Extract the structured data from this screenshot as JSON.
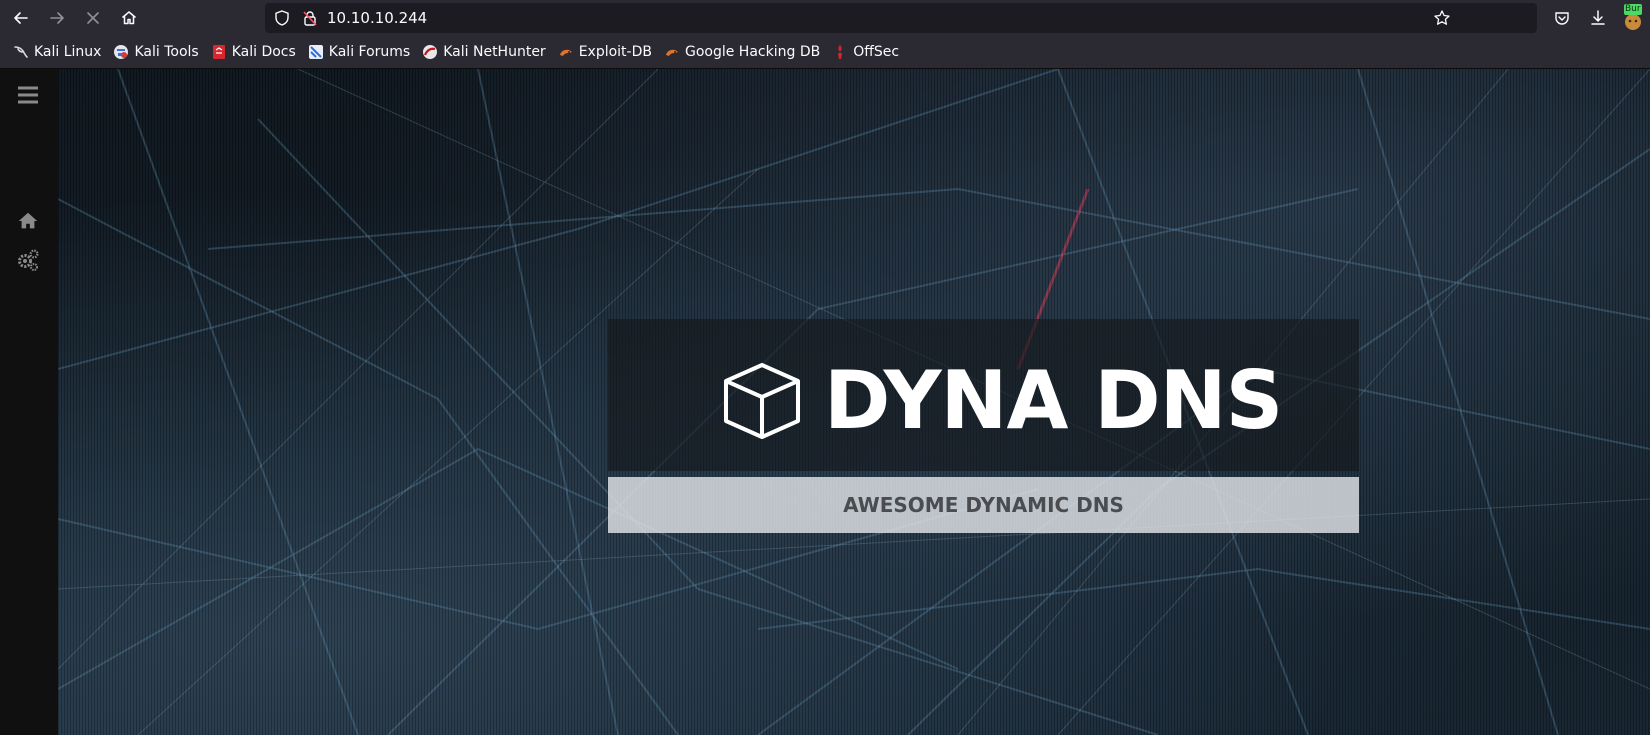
{
  "browser": {
    "url": "10.10.10.244",
    "extension_badge": "Bur"
  },
  "bookmarks": [
    {
      "label": "Kali Linux",
      "icon": "kali-dragon-icon"
    },
    {
      "label": "Kali Tools",
      "icon": "kali-tools-icon"
    },
    {
      "label": "Kali Docs",
      "icon": "kali-docs-icon"
    },
    {
      "label": "Kali Forums",
      "icon": "kali-forums-icon"
    },
    {
      "label": "Kali NetHunter",
      "icon": "nethunter-icon"
    },
    {
      "label": "Exploit-DB",
      "icon": "exploit-db-icon"
    },
    {
      "label": "Google Hacking DB",
      "icon": "ghdb-icon"
    },
    {
      "label": "OffSec",
      "icon": "offsec-icon"
    }
  ],
  "sidebar": {
    "items": [
      {
        "icon": "menu-icon"
      },
      {
        "icon": "home-icon"
      },
      {
        "icon": "gears-icon"
      }
    ]
  },
  "hero": {
    "brand": "DYNA DNS",
    "tagline": "AWESOME DYNAMIC DNS",
    "logo_icon": "cube-icon"
  },
  "colors": {
    "browser_chrome": "#2b2a33",
    "urlbar": "#1c1b22",
    "sidebar": "#101010",
    "tagline_bg": "#e1e4e8",
    "tagline_text": "#4a4c50"
  }
}
